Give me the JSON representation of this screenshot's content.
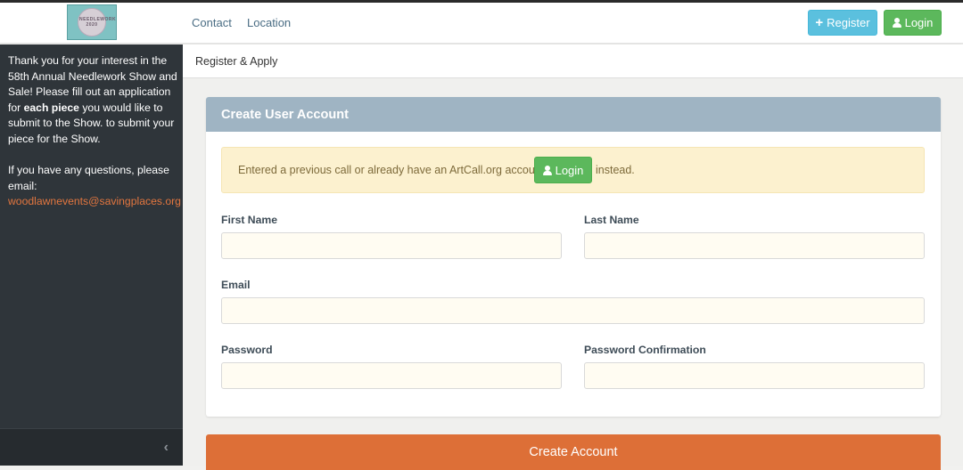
{
  "nav": {
    "logo_text": "NEEDLEWORK 2020",
    "links": [
      "Contact",
      "Location"
    ],
    "register_label": "Register",
    "login_label": "Login"
  },
  "sidebar": {
    "intro_part1": "Thank you for your interest in the 58th Annual Needlework Show and Sale! Please fill out an application for ",
    "intro_bold": "each piece",
    "intro_part2": " you would like to submit to the Show. to submit your piece for the Show.",
    "questions_text": "If you have any questions, please email:",
    "email": "woodlawnevents@savingplaces.org",
    "collapse_icon": "chevron-left-icon"
  },
  "breadcrumb": "Register & Apply",
  "card": {
    "title": "Create User Account",
    "alert_text": "Entered a previous call or already have an ArtCall.org account?",
    "alert_login_label": "Login",
    "alert_suffix": "instead.",
    "fields": {
      "first_name": {
        "label": "First Name",
        "value": ""
      },
      "last_name": {
        "label": "Last Name",
        "value": ""
      },
      "email": {
        "label": "Email",
        "value": ""
      },
      "password": {
        "label": "Password",
        "value": ""
      },
      "password_confirmation": {
        "label": "Password Confirmation",
        "value": ""
      }
    }
  },
  "submit_label": "Create Account",
  "colors": {
    "accent_orange": "#dd6f37",
    "header_blue_gray": "#9fb4c3",
    "register_blue": "#5bc0de",
    "login_green": "#5cb85c",
    "sidebar_dark": "#2f353a",
    "alert_bg": "#fcf1cf"
  }
}
